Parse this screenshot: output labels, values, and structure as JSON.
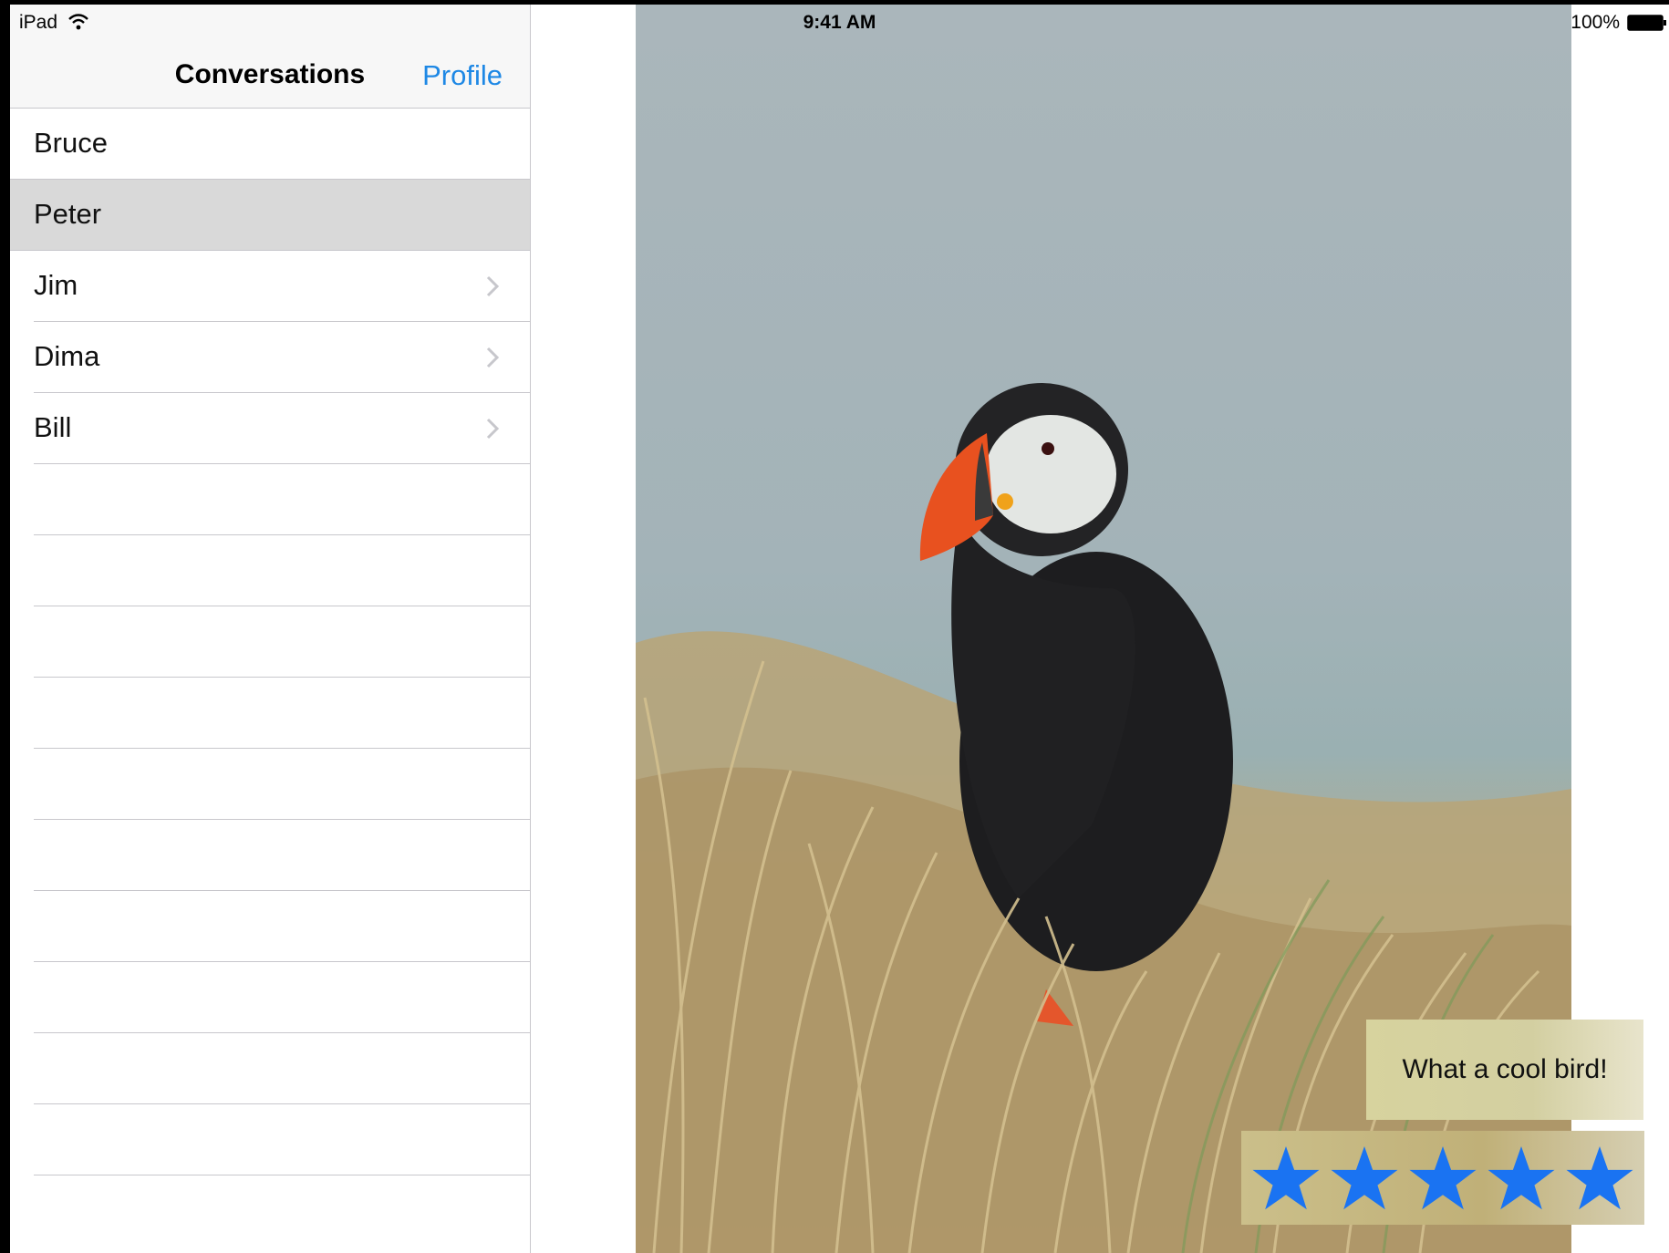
{
  "status_bar": {
    "device": "iPad",
    "time": "9:41 AM",
    "battery_text": "100%"
  },
  "master": {
    "title": "Conversations",
    "profile_button": "Profile",
    "conversations": [
      {
        "name": "Bruce",
        "selected": false,
        "chevron": false
      },
      {
        "name": "Peter",
        "selected": true,
        "chevron": false
      },
      {
        "name": "Jim",
        "selected": false,
        "chevron": true
      },
      {
        "name": "Dima",
        "selected": false,
        "chevron": true
      },
      {
        "name": "Bill",
        "selected": false,
        "chevron": true
      }
    ]
  },
  "detail": {
    "caption": "What a cool bird!",
    "rating": {
      "value": 5,
      "max": 5
    },
    "colors": {
      "star": "#1a73f2",
      "accent": "#1e88e5"
    }
  }
}
